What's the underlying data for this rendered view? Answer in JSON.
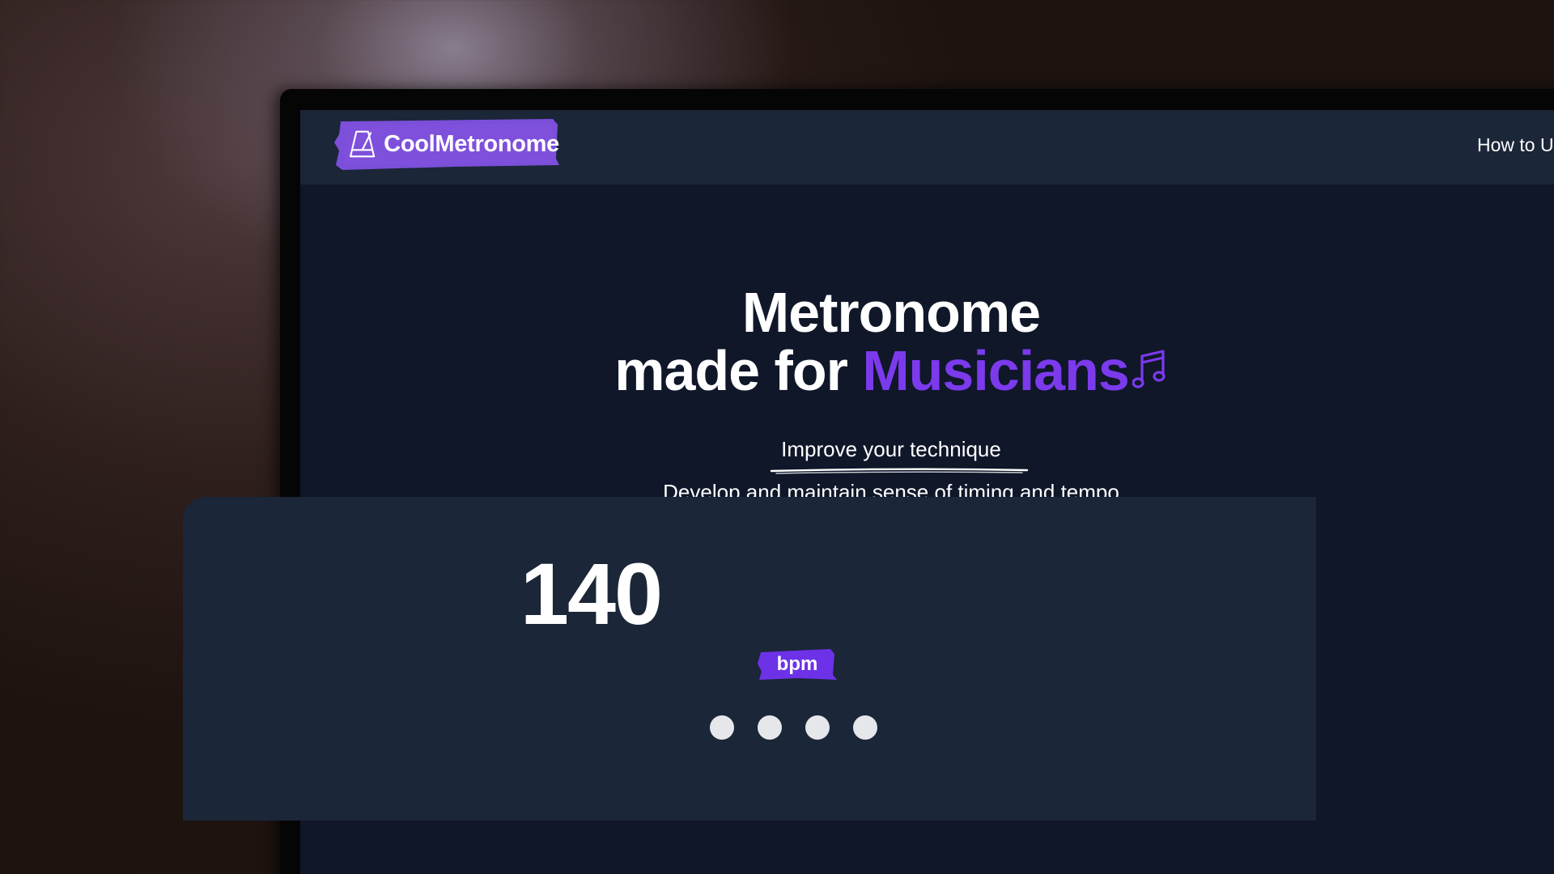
{
  "header": {
    "logo_text": "CoolMetronome",
    "nav_link": "How to U"
  },
  "hero": {
    "title_line1": "Metronome",
    "title_line2_prefix": "made for ",
    "title_line2_accent": "Musicians",
    "subtitle1": "Improve your technique",
    "subtitle2": "Develop and maintain sense of timing and tempo"
  },
  "metronome": {
    "bpm": "140",
    "unit": "bpm",
    "beats": 4
  },
  "colors": {
    "accent": "#7c3aed",
    "background": "#0f1729",
    "panel": "#1b2638"
  },
  "icons": [
    "metronome-icon",
    "music-note-icon"
  ]
}
